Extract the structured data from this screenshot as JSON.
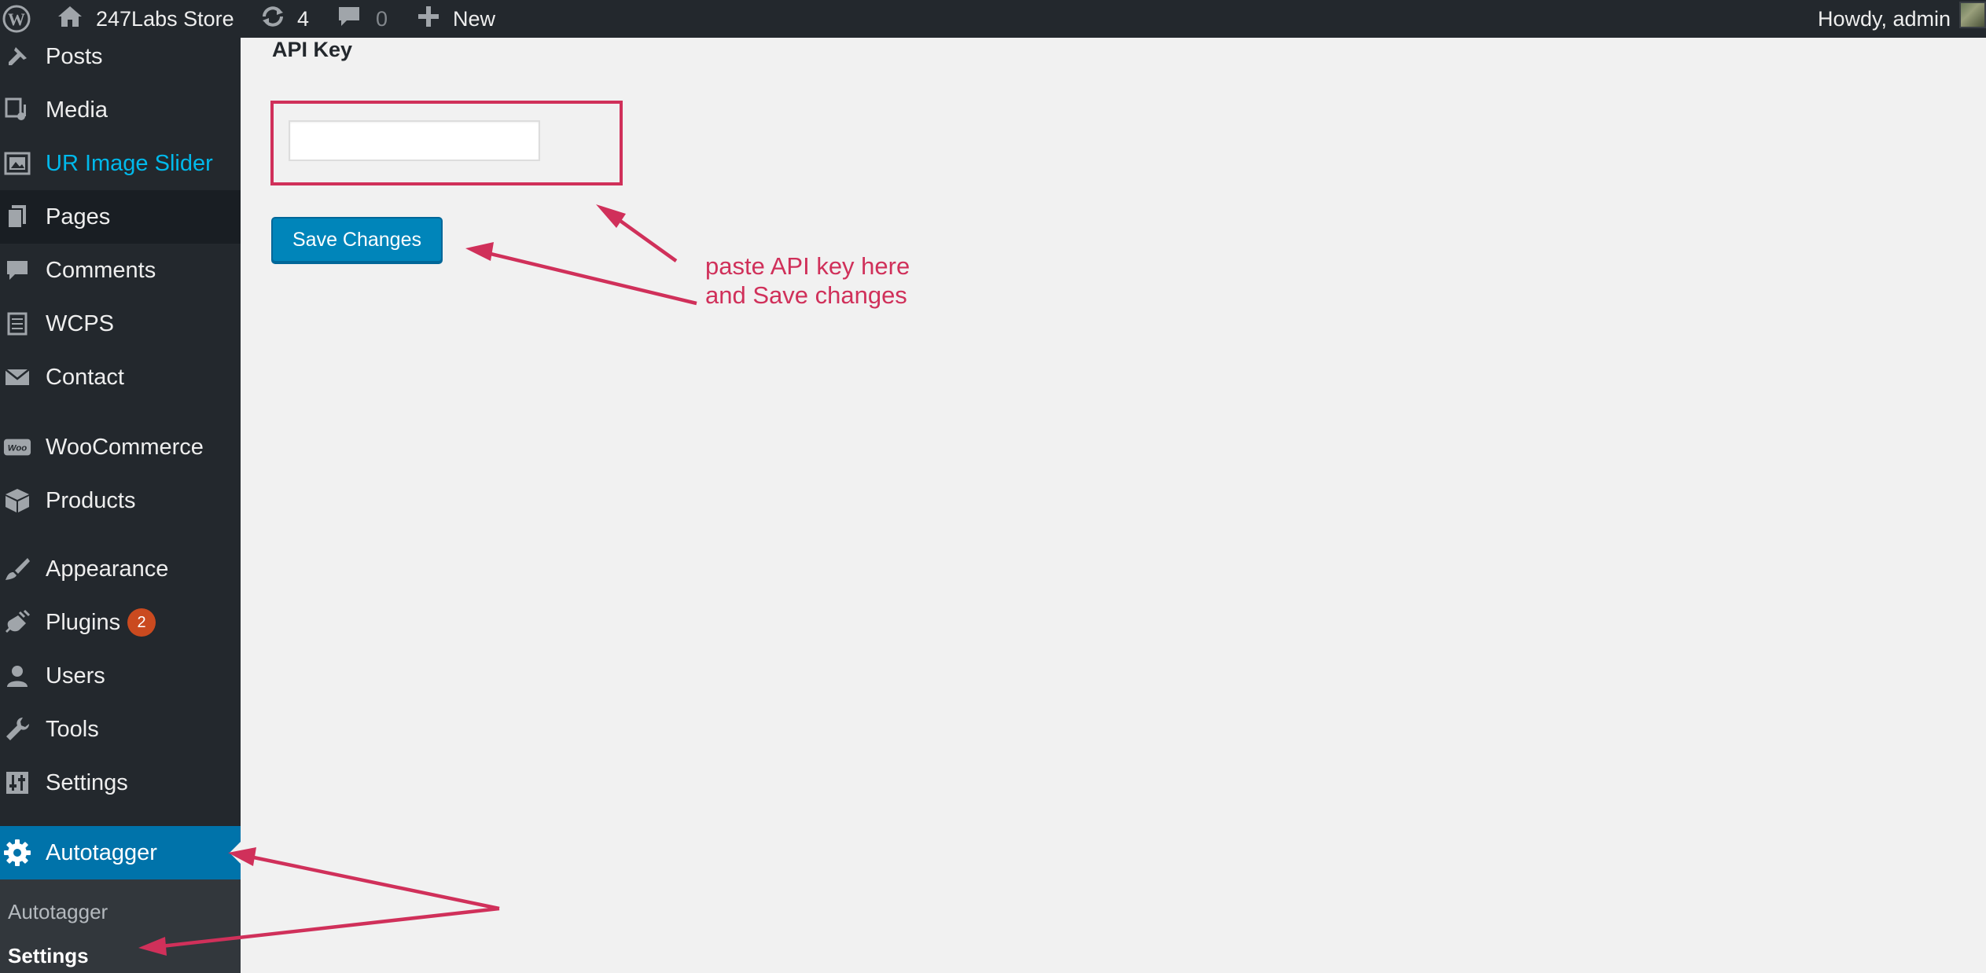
{
  "admin_bar": {
    "site_name": "247Labs Store",
    "updates_count": "4",
    "comments_count": "0",
    "new_label": "New",
    "greeting": "Howdy, admin"
  },
  "sidebar": {
    "items": [
      {
        "label": "Posts",
        "icon": "pushpin-icon"
      },
      {
        "label": "Media",
        "icon": "media-icon"
      },
      {
        "label": "UR Image Slider",
        "icon": "gallery-icon"
      },
      {
        "label": "Pages",
        "icon": "pages-icon"
      },
      {
        "label": "Comments",
        "icon": "comment-icon"
      },
      {
        "label": "WCPS",
        "icon": "list-icon"
      },
      {
        "label": "Contact",
        "icon": "mail-icon"
      },
      {
        "label": "WooCommerce",
        "icon": "woo-icon"
      },
      {
        "label": "Products",
        "icon": "box-icon"
      },
      {
        "label": "Appearance",
        "icon": "brush-icon"
      },
      {
        "label": "Plugins",
        "icon": "plug-icon",
        "badge": "2"
      },
      {
        "label": "Users",
        "icon": "user-icon"
      },
      {
        "label": "Tools",
        "icon": "wrench-icon"
      },
      {
        "label": "Settings",
        "icon": "sliders-icon"
      },
      {
        "label": "Autotagger",
        "icon": "gear-icon"
      }
    ],
    "submenu": [
      "Autotagger",
      "Settings"
    ]
  },
  "main": {
    "section_label": "API Key",
    "api_key_value": "",
    "save_label": "Save Changes"
  },
  "annotation": {
    "line1": "paste API key here",
    "line2": "and Save changes"
  },
  "colors": {
    "admin_bar": "#23282d",
    "active_menu": "#0073aa",
    "button": "#0085ba",
    "annotation": "#d0305a",
    "badge": "#ca4a1f"
  }
}
